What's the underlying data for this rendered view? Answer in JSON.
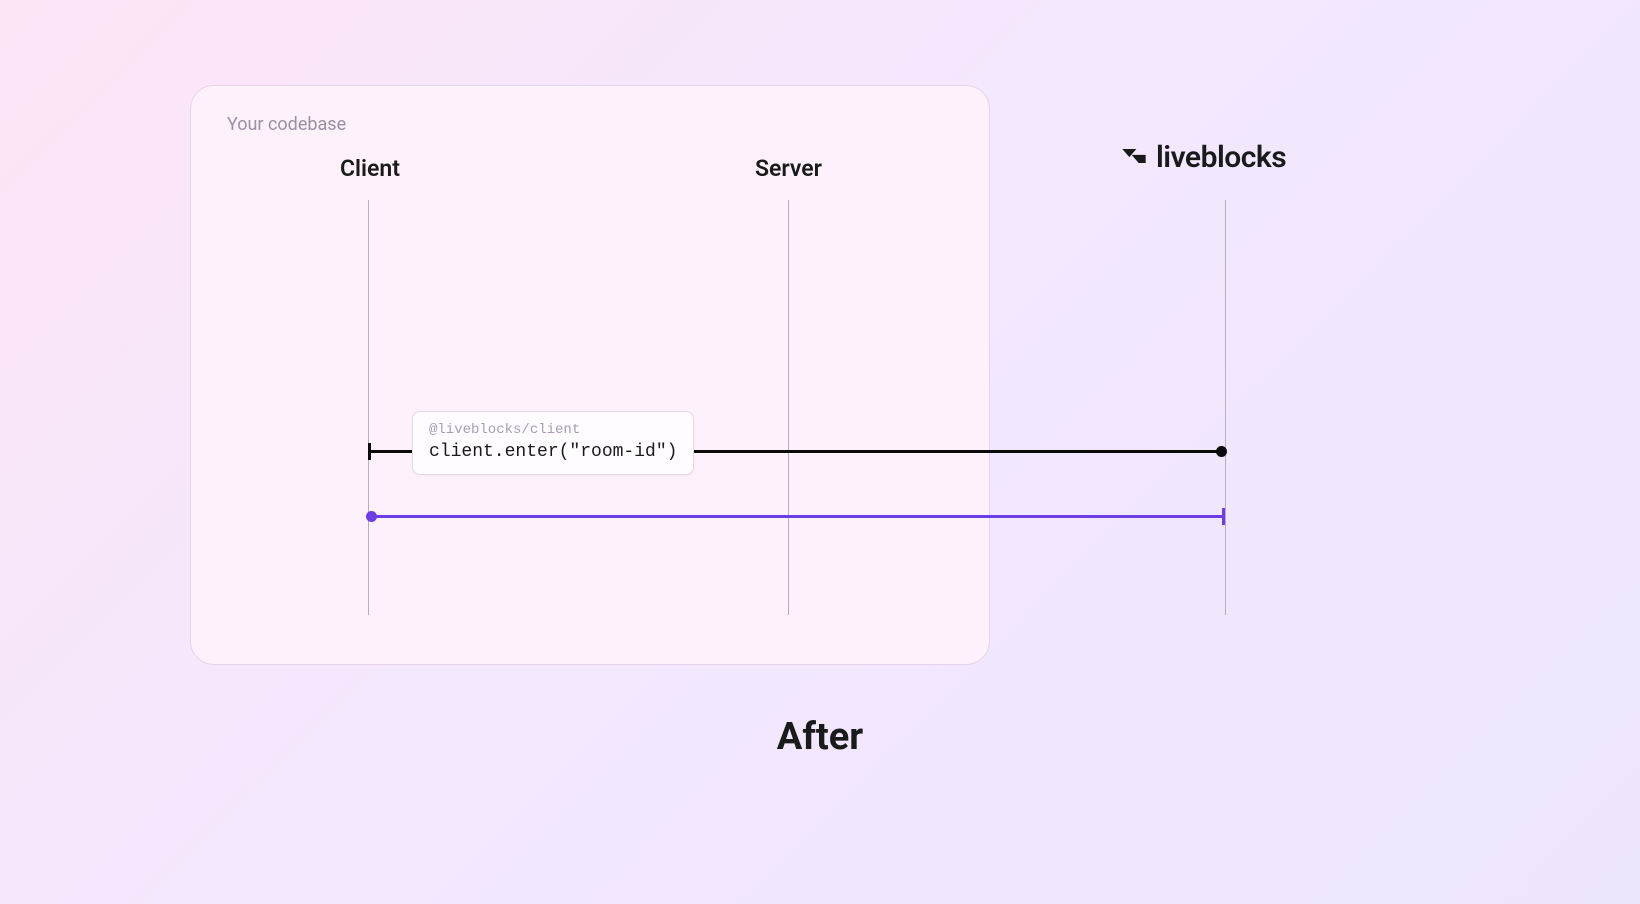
{
  "card": {
    "label": "Your codebase"
  },
  "columns": {
    "client": "Client",
    "server": "Server"
  },
  "liveblocks": {
    "brand": "liveblocks"
  },
  "tooltip": {
    "package": "@liveblocks/client",
    "code": "client.enter(\"room-id\")"
  },
  "footer": {
    "title": "After"
  },
  "colors": {
    "arrow_request": "#0a0a0a",
    "arrow_response": "#6b3ee8"
  }
}
